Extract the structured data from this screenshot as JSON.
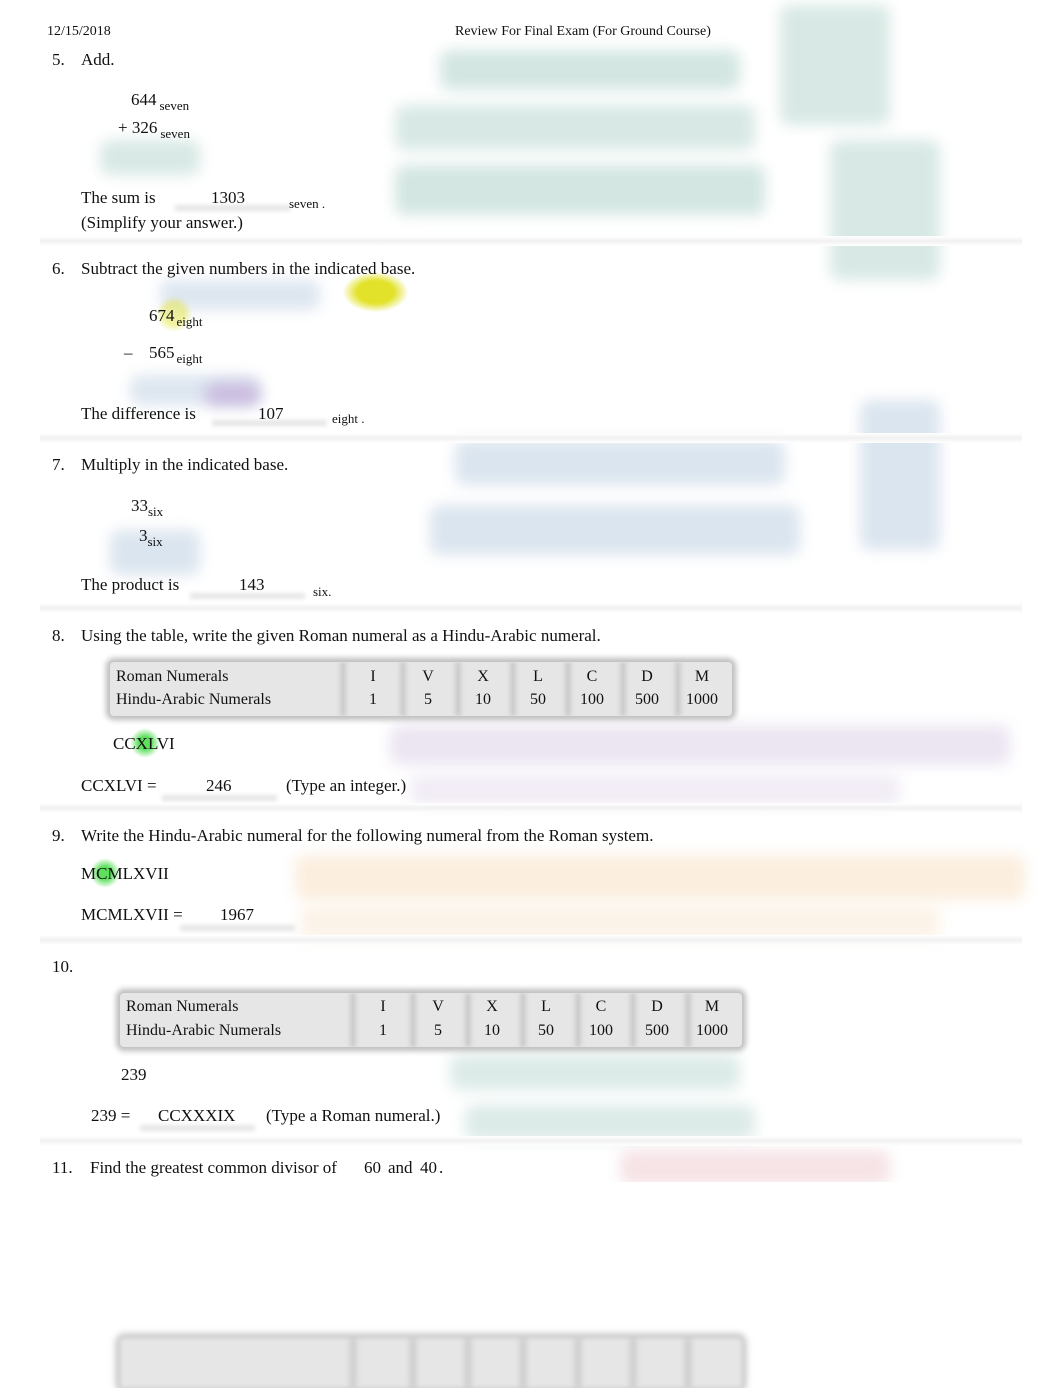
{
  "header": {
    "date": "12/15/2018",
    "title": "Review For Final Exam (For Ground Course)"
  },
  "problems": {
    "p5": {
      "number": "5.",
      "prompt": "Add.",
      "top_value": "644",
      "bottom_operator": "+",
      "bottom_value": "326",
      "base": "seven",
      "answer_prefix": "The sum is",
      "answer": "1303",
      "answer_base": "seven",
      "answer_suffix": ".",
      "hint": "(Simplify your answer.)"
    },
    "p6": {
      "number": "6.",
      "prompt": "Subtract the given numbers in the indicated base.",
      "top_value": "674",
      "bottom_operator": "–",
      "bottom_value": "565",
      "base": "eight",
      "answer_prefix": "The difference is",
      "answer": "107",
      "answer_base": "eight",
      "answer_suffix": "."
    },
    "p7": {
      "number": "7.",
      "prompt": "Multiply in the indicated base.",
      "top_value": "33",
      "bottom_value": "3",
      "base": "six",
      "answer_prefix": "The product is",
      "answer": "143",
      "answer_base": "six",
      "answer_suffix": "."
    },
    "p8": {
      "number": "8.",
      "prompt": "Using the table, write the given Roman numeral as a Hindu-Arabic numeral.",
      "given": "CCXLVI",
      "answer_prefix": "CCXLVI =",
      "answer": "246",
      "hint": "(Type an integer.)"
    },
    "p9": {
      "number": "9.",
      "prompt": "Write the Hindu-Arabic numeral for the following numeral from the Roman system.",
      "given": "MCMLXVII",
      "answer_prefix": "MCMLXVII =",
      "answer": "1967"
    },
    "p10": {
      "number": "10.",
      "given": "239",
      "answer_prefix": "239 =",
      "answer": "CCXXXIX",
      "hint": "(Type a Roman numeral.)"
    },
    "p11": {
      "number": "11.",
      "prompt": "Find the greatest common divisor of",
      "a": "60",
      "conj": "and",
      "b": "40",
      "suffix": "."
    }
  },
  "roman_table": {
    "row_labels": [
      "Roman Numerals",
      "Hindu-Arabic Numerals"
    ],
    "roman": [
      "I",
      "V",
      "X",
      "L",
      "C",
      "D",
      "M"
    ],
    "arabic": [
      "1",
      "5",
      "10",
      "50",
      "100",
      "500",
      "1000"
    ]
  },
  "annotation_colors": {
    "teal_handwriting": "#bcd8d3",
    "blue_handwriting": "#c3d4e6",
    "purple_handwriting": "#d9cde3",
    "orange_handwriting": "#f3dcc0",
    "green_highlight": "#5ee05e",
    "yellow_highlight": "#e2e22a"
  }
}
